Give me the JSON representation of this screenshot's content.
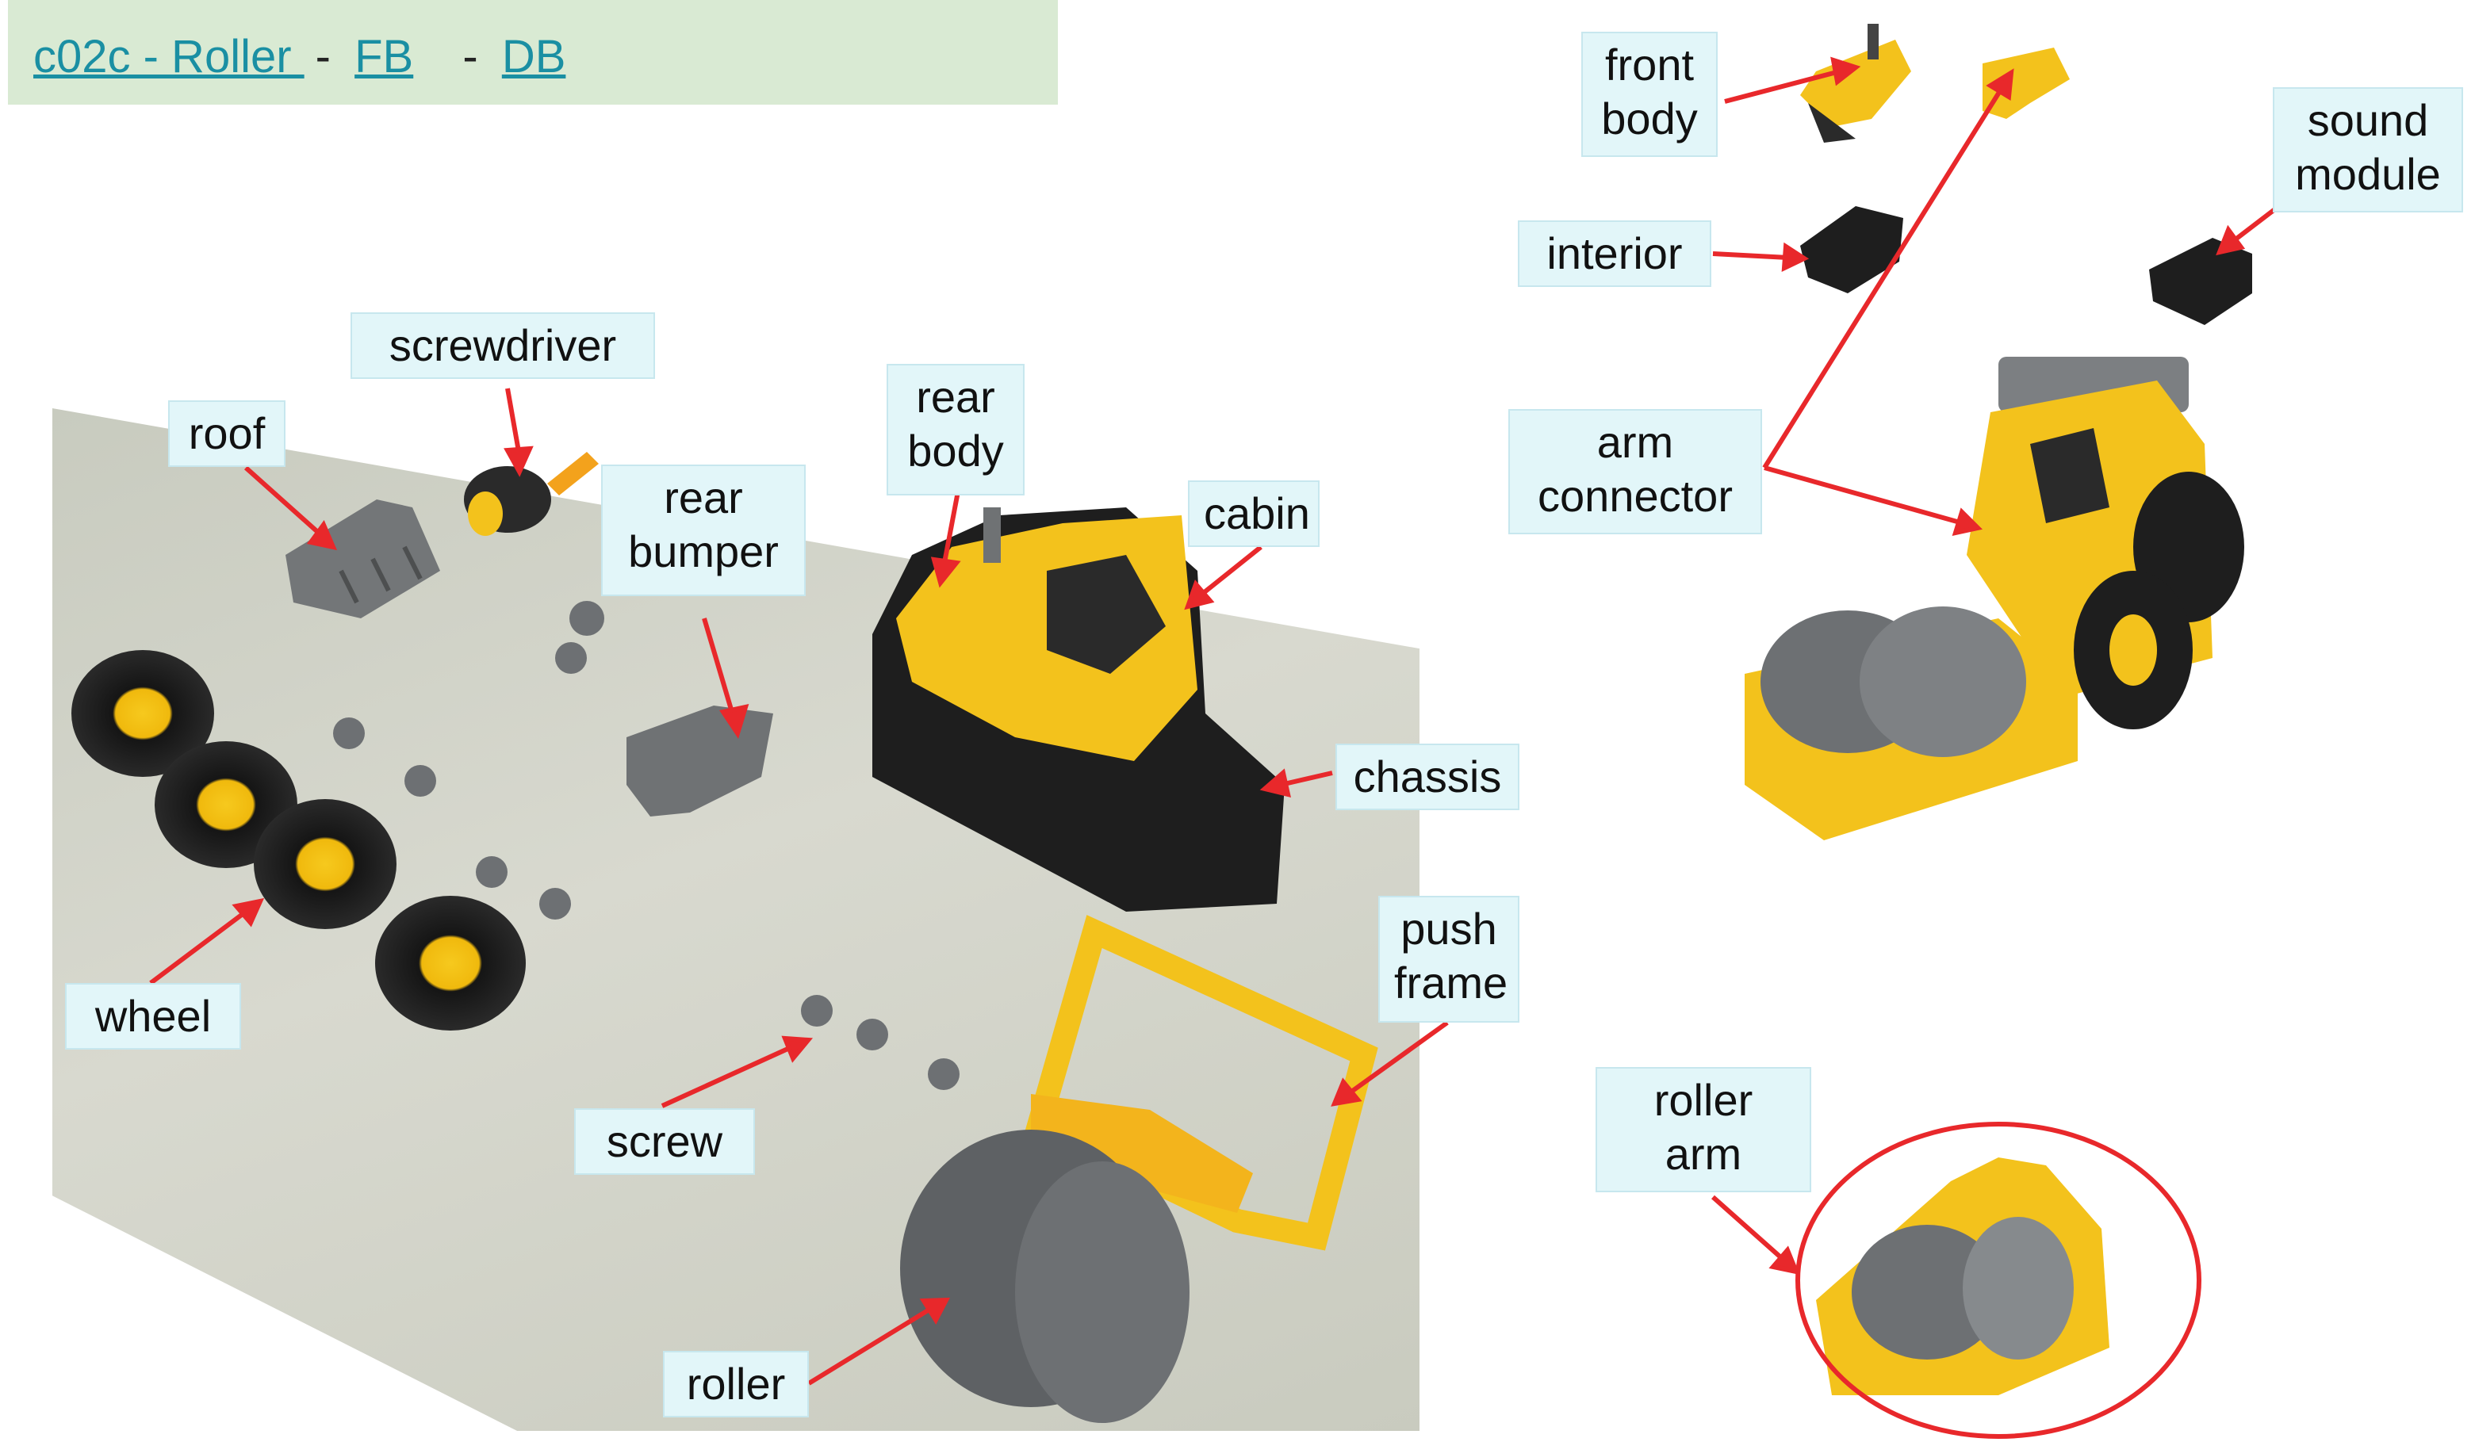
{
  "header": {
    "title_link": "c02c - Roller ",
    "sep1": "-",
    "fb_link": "FB",
    "sep2": "-",
    "db_link": "DB"
  },
  "labels": {
    "screwdriver": "screwdriver",
    "roof": "roof",
    "rear_bumper": "rear\nbumper",
    "rear_body": "rear\nbody",
    "cabin": "cabin",
    "chassis": "chassis",
    "wheel": "wheel",
    "push_frame": "push\nframe",
    "screw": "screw",
    "roller": "roller",
    "front_body": "front\nbody",
    "interior": "interior",
    "sound_module": "sound\nmodule",
    "arm_connector": "arm\nconnector",
    "roller_arm": "roller\narm"
  },
  "colors": {
    "arrow": "#e8282b",
    "label_bg": "#e2f6f9",
    "header_bg": "#d9ead3",
    "link": "#1a8fa3",
    "toy_yellow": "#f3c21c",
    "toy_gray": "#777a7d",
    "toy_black": "#1e1e1e"
  }
}
